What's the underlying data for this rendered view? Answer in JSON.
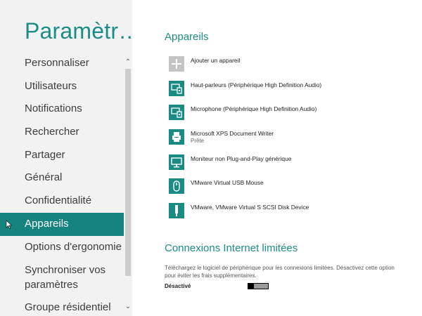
{
  "sidebar": {
    "title": "Paramètr…",
    "items": [
      {
        "label": "Personnaliser"
      },
      {
        "label": "Utilisateurs"
      },
      {
        "label": "Notifications"
      },
      {
        "label": "Rechercher"
      },
      {
        "label": "Partager"
      },
      {
        "label": "Général"
      },
      {
        "label": "Confidentialité"
      },
      {
        "label": "Appareils",
        "active": true
      },
      {
        "label": "Options d'ergonomie"
      },
      {
        "label": "Synchroniser vos paramètres"
      },
      {
        "label": "Groupe résidentiel"
      }
    ]
  },
  "devices": {
    "title": "Appareils",
    "items": [
      {
        "name": "Ajouter un appareil",
        "icon": "add-icon"
      },
      {
        "name": "Haut-parleurs (Périphérique High Definition Audio)",
        "icon": "audio-device-icon"
      },
      {
        "name": "Microphone (Périphérique High Definition Audio)",
        "icon": "audio-device-icon"
      },
      {
        "name": "Microsoft XPS Document Writer",
        "status": "Prête",
        "icon": "printer-icon"
      },
      {
        "name": "Moniteur non Plug-and-Play générique",
        "icon": "monitor-icon"
      },
      {
        "name": "VMware Virtual USB Mouse",
        "icon": "mouse-icon"
      },
      {
        "name": "VMware, VMware Virtual S SCSI Disk Device",
        "icon": "disk-icon"
      }
    ]
  },
  "metered": {
    "title": "Connexions Internet limitées",
    "description": "Téléchargez le logiciel de périphérique pour les connexions limitées. Désactivez cette option pour éviter les frais supplémentaires.",
    "toggle_label": "Désactivé",
    "toggle_on": false
  },
  "colors": {
    "accent": "#1b8d86",
    "selected_bg": "#168380",
    "icon_bg": "#1a8a84",
    "sidebar_bg": "#f2f2f2"
  }
}
